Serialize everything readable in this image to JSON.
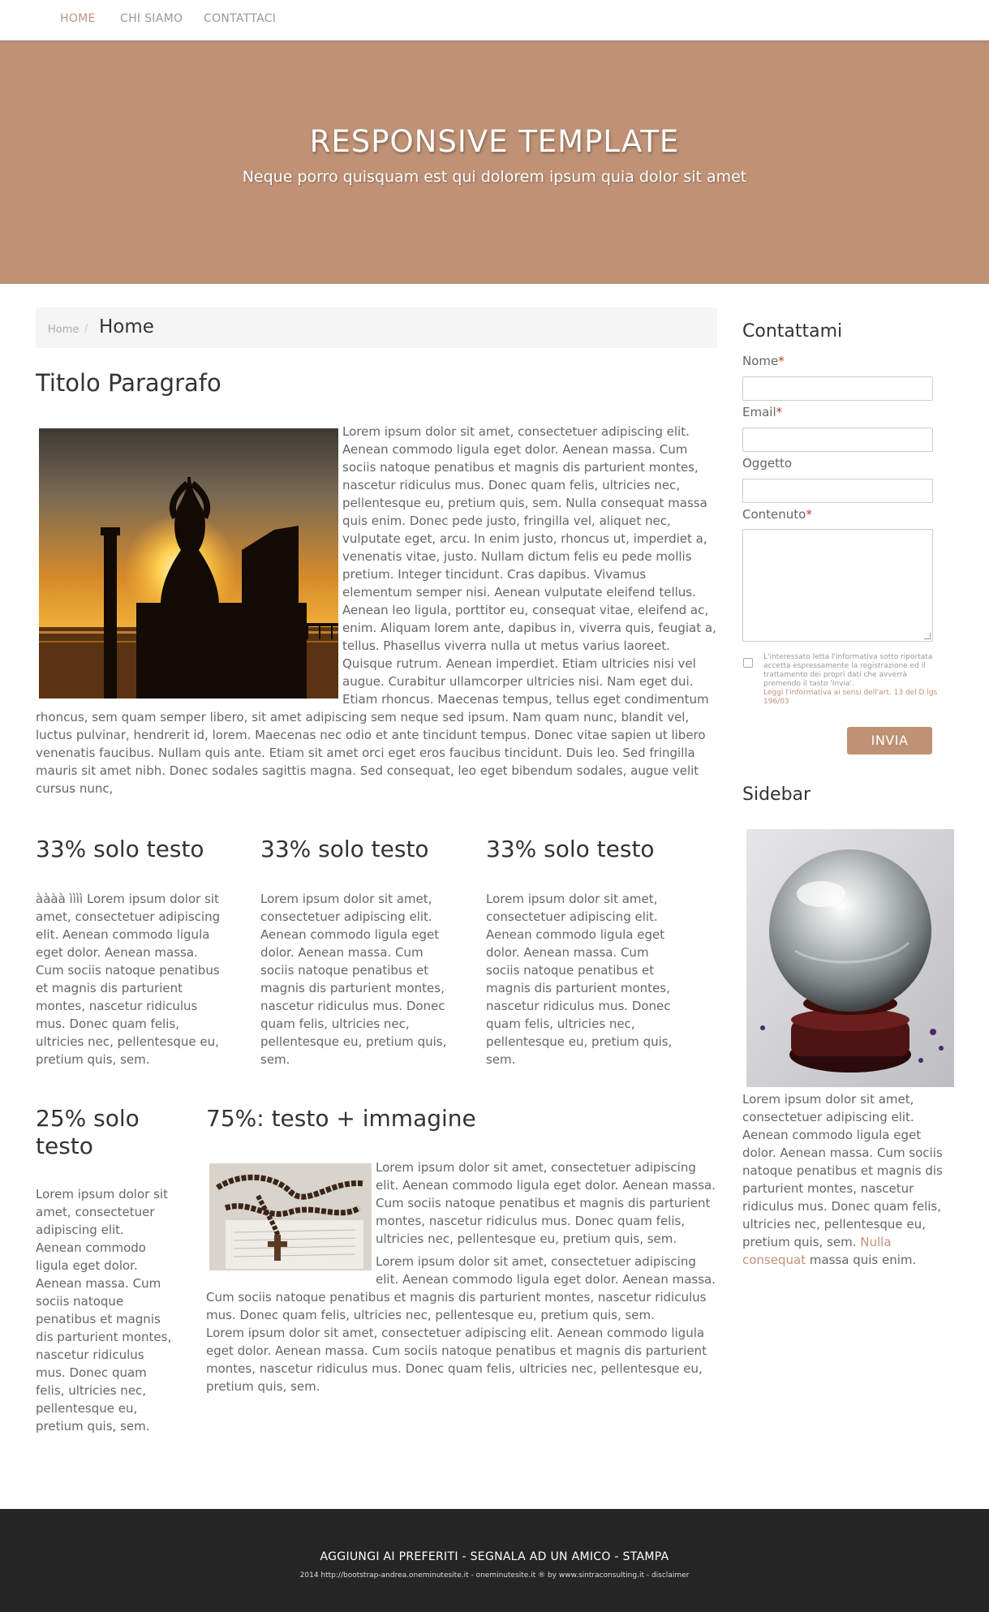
{
  "nav": {
    "items": [
      {
        "label": "HOME",
        "active": true
      },
      {
        "label": "CHI SIAMO",
        "active": false
      },
      {
        "label": "CONTATTACI",
        "active": false
      }
    ]
  },
  "hero": {
    "title": "RESPONSIVE TEMPLATE",
    "subtitle": "Neque porro quisquam est qui dolorem ipsum quia dolor sit amet"
  },
  "breadcrumb": {
    "link": "Home",
    "separator": "/",
    "current": "Home"
  },
  "main": {
    "title": "Titolo Paragrafo",
    "image_icon": "meditation-sunset-photo",
    "text": "Lorem ipsum dolor sit amet, consectetuer adipiscing elit. Aenean commodo ligula eget dolor. Aenean massa. Cum sociis natoque penatibus et magnis dis parturient montes, nascetur ridiculus mus. Donec quam felis, ultricies nec, pellentesque eu, pretium quis, sem. Nulla consequat massa quis enim. Donec pede justo, fringilla vel, aliquet nec, vulputate eget, arcu. In enim justo, rhoncus ut, imperdiet a, venenatis vitae, justo. Nullam dictum felis eu pede mollis pretium. Integer tincidunt. Cras dapibus. Vivamus elementum semper nisi. Aenean vulputate eleifend tellus. Aenean leo ligula, porttitor eu, consequat vitae, eleifend ac, enim. Aliquam lorem ante, dapibus in, viverra quis, feugiat a, tellus. Phasellus viverra nulla ut metus varius laoreet. Quisque rutrum. Aenean imperdiet. Etiam ultricies nisi vel augue. Curabitur ullamcorper ultricies nisi. Nam eget dui. Etiam rhoncus. Maecenas tempus, tellus eget condimentum rhoncus, sem quam semper libero, sit amet adipiscing sem neque sed ipsum. Nam quam nunc, blandit vel, luctus pulvinar, hendrerit id, lorem. Maecenas nec odio et ante tincidunt tempus. Donec vitae sapien ut libero venenatis faucibus. Nullam quis ante. Etiam sit amet orci eget eros faucibus tincidunt. Duis leo. Sed fringilla mauris sit amet nibh. Donec sodales sagittis magna. Sed consequat, leo eget bibendum sodales, augue velit cursus nunc,"
  },
  "thirds": [
    {
      "title": "33% solo testo",
      "text": "àààà ìììì Lorem ipsum dolor sit amet, consectetuer adipiscing elit. Aenean commodo ligula eget dolor. Aenean massa. Cum sociis natoque penatibus et magnis dis parturient montes, nascetur ridiculus mus. Donec quam felis, ultricies nec, pellentesque eu, pretium quis, sem."
    },
    {
      "title": "33% solo testo",
      "text": "Lorem ipsum dolor sit amet, consectetuer adipiscing elit. Aenean commodo ligula eget dolor. Aenean massa. Cum sociis natoque penatibus et magnis dis parturient montes, nascetur ridiculus mus. Donec quam felis, ultricies nec, pellentesque eu, pretium quis, sem."
    },
    {
      "title": "33% solo testo",
      "text": "Lorem ipsum dolor sit amet, consectetuer adipiscing elit. Aenean commodo ligula eget dolor. Aenean massa. Cum sociis natoque penatibus et magnis dis parturient montes, nascetur ridiculus mus. Donec quam felis, ultricies nec, pellentesque eu, pretium quis, sem."
    }
  ],
  "quarter": {
    "title": "25% solo testo",
    "text": "Lorem ipsum dolor sit amet, consectetuer adipiscing elit. Aenean commodo ligula eget dolor. Aenean massa. Cum sociis natoque penatibus et magnis dis parturient montes, nascetur ridiculus mus. Donec quam felis, ultricies nec, pellentesque eu, pretium quis, sem."
  },
  "three_quarter": {
    "title": "75%: testo + immagine",
    "image_icon": "rosary-photo",
    "paragraphs": [
      "Lorem ipsum dolor sit amet, consectetuer adipiscing elit. Aenean commodo ligula eget dolor. Aenean massa. Cum sociis natoque penatibus et magnis dis parturient montes, nascetur ridiculus mus. Donec quam felis, ultricies nec, pellentesque eu, pretium quis, sem.",
      "Lorem ipsum dolor sit amet, consectetuer adipiscing elit. Aenean commodo ligula eget dolor. Aenean massa. Cum sociis natoque penatibus et magnis dis parturient montes, nascetur ridiculus mus. Donec quam felis, ultricies nec, pellentesque eu, pretium quis, sem.",
      "Lorem ipsum dolor sit amet, consectetuer adipiscing elit. Aenean commodo ligula eget dolor. Aenean massa. Cum sociis natoque penatibus et magnis dis parturient montes, nascetur ridiculus mus. Donec quam felis, ultricies nec, pellentesque eu, pretium quis, sem."
    ]
  },
  "contact": {
    "title": "Contattami",
    "name_label": "Nome",
    "email_label": "Email",
    "subject_label": "Oggetto",
    "content_label": "Contenuto",
    "required_mark": "*",
    "name_value": "",
    "email_value": "",
    "subject_value": "",
    "content_value": "",
    "privacy_text": "L'interessato letta l'informativa sotto riportata accetta espressamente la registrazione ed il trattamento dei propri dati che avverrà premendo il tasto 'Invia'.",
    "privacy_link": "Leggi l'informativa ai sensi dell'art. 13 del D.lgs 196/03",
    "submit_label": "INVIA"
  },
  "sidebar": {
    "title": "Sidebar",
    "image_icon": "crystal-ball-photo",
    "text_before": "Lorem ipsum dolor sit amet, consectetuer adipiscing elit. Aenean commodo ligula eget dolor. Aenean massa. Cum sociis natoque penatibus et magnis dis parturient montes, nascetur ridiculus mus. Donec quam felis, ultricies nec, pellentesque eu, pretium quis, sem. ",
    "link": "Nulla consequat",
    "text_after": " massa quis enim."
  },
  "footer": {
    "link1": "AGGIUNGI AI PREFERITI",
    "link2": "SEGNALA AD UN AMICO",
    "link3": "STAMPA",
    "separator": " - ",
    "credits": "2014  http://bootstrap-andrea.oneminutesite.it - oneminutesite.it ® by www.sintraconsulting.it - disclaimer"
  },
  "colors": {
    "accent": "#bf9175",
    "link": "#c0917a",
    "footer_bg": "#252525"
  }
}
